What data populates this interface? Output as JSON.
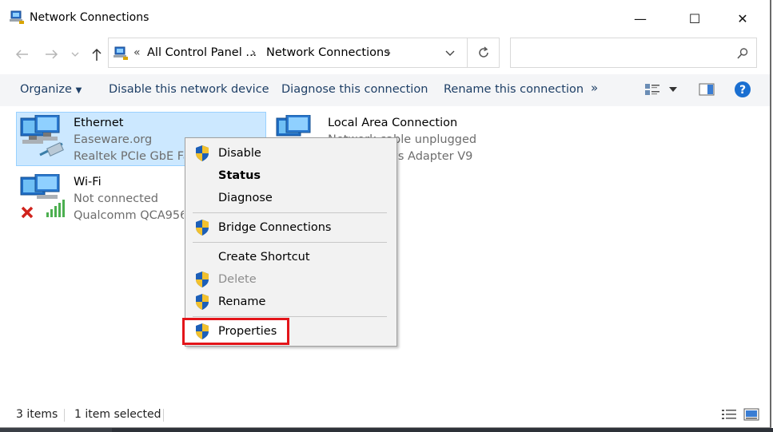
{
  "window": {
    "title": "Network Connections"
  },
  "window_controls": {
    "minimize": "—",
    "maximize": "☐",
    "close": "✕"
  },
  "address": {
    "separator_left": "«",
    "crumbs": [
      "All Control Panel ...",
      "Network Connections"
    ],
    "chevron": "›",
    "search_placeholder": ""
  },
  "commands": {
    "organize": "Organize",
    "disable": "Disable this network device",
    "diagnose": "Diagnose this connection",
    "rename": "Rename this connection",
    "more": "»"
  },
  "items": [
    {
      "name": "Ethernet",
      "line1": "Easeware.org",
      "line2": "Realtek PCIe GbE Fan"
    },
    {
      "name": "Local Area Connection",
      "line1": "Network cable unplugged",
      "line2": "TAP-Windows Adapter V9"
    },
    {
      "name": "Wi-Fi",
      "line1": "Not connected",
      "line2": "Qualcomm QCA9565"
    }
  ],
  "context_menu": {
    "disable": "Disable",
    "status": "Status",
    "diagnose": "Diagnose",
    "bridge": "Bridge Connections",
    "shortcut": "Create Shortcut",
    "delete": "Delete",
    "rename": "Rename",
    "properties": "Properties"
  },
  "statusbar": {
    "count": "3 items",
    "selected": "1 item selected"
  },
  "colors": {
    "accent": "#1e3f66",
    "selection": "#cce8ff",
    "highlight": "#e3151a",
    "help": "#1a6fd1"
  }
}
